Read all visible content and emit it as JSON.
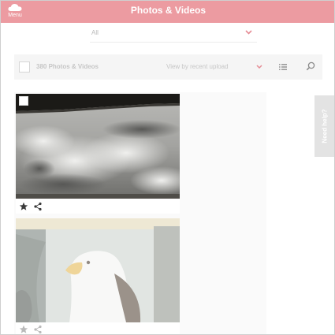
{
  "header": {
    "menu_label": "Menu",
    "title": "Photos & Videos",
    "background": "#ec9ba1"
  },
  "filter": {
    "value": "All"
  },
  "toolbar": {
    "count_label": "380 Photos & Videos",
    "sort_label": "View by recent upload"
  },
  "icons": {
    "menu": "cloud-icon",
    "filter_chevron": "chevron-down-icon",
    "sort_chevron": "chevron-down-icon",
    "list_view": "list-view-icon",
    "search": "search-icon",
    "favorite": "star-icon",
    "share": "share-icon"
  },
  "photos": [
    {
      "subject": "cloudy sky"
    },
    {
      "subject": "bald eagle"
    }
  ],
  "help": {
    "label": "Need help?"
  },
  "colors": {
    "accent": "#ec9ba1",
    "chevron": "#e58c95"
  }
}
